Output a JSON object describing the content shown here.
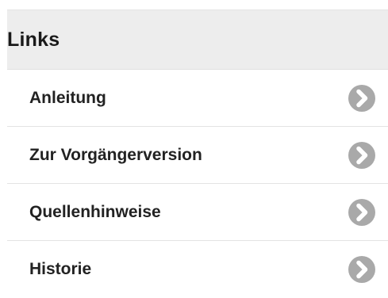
{
  "panel": {
    "title": "Links",
    "items": [
      {
        "label": "Anleitung",
        "icon": "chevron-right-circle-icon"
      },
      {
        "label": "Zur Vorgängerversion",
        "icon": "chevron-right-circle-icon"
      },
      {
        "label": "Quellenhinweise",
        "icon": "chevron-right-circle-icon"
      },
      {
        "label": "Historie",
        "icon": "chevron-right-circle-icon"
      }
    ]
  },
  "colors": {
    "header_background": "#ededed",
    "icon_circle": "#a9a9a9",
    "icon_chevron": "#ffffff",
    "divider": "#e3e3e3"
  }
}
